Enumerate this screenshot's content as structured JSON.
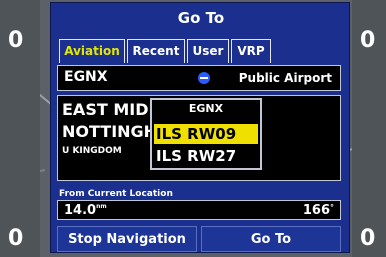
{
  "dialog": {
    "title": "Go To"
  },
  "tabs": [
    {
      "label": "Aviation",
      "active": true
    },
    {
      "label": "Recent",
      "active": false
    },
    {
      "label": "User",
      "active": false
    },
    {
      "label": "VRP",
      "active": false
    }
  ],
  "identifier": {
    "value": "EGNX",
    "type": "Public Airport"
  },
  "info": {
    "line1": "EAST MIDL",
    "line2": "NOTTINGH",
    "line3": "U KINGDOM"
  },
  "popup": {
    "title": "EGNX",
    "items": [
      {
        "label": "ILS RW09",
        "selected": true
      },
      {
        "label": "ILS RW27",
        "selected": false
      }
    ]
  },
  "from_location": {
    "label": "From Current Location",
    "distance": "14.0",
    "distance_unit": "nm",
    "bearing": "166",
    "bearing_unit": "°"
  },
  "buttons": {
    "stop": "Stop Navigation",
    "goto": "Go To"
  },
  "colors": {
    "dialog_bg": "#1a2f8e",
    "active_tab": "#e5e600",
    "highlight": "#f0e000"
  }
}
